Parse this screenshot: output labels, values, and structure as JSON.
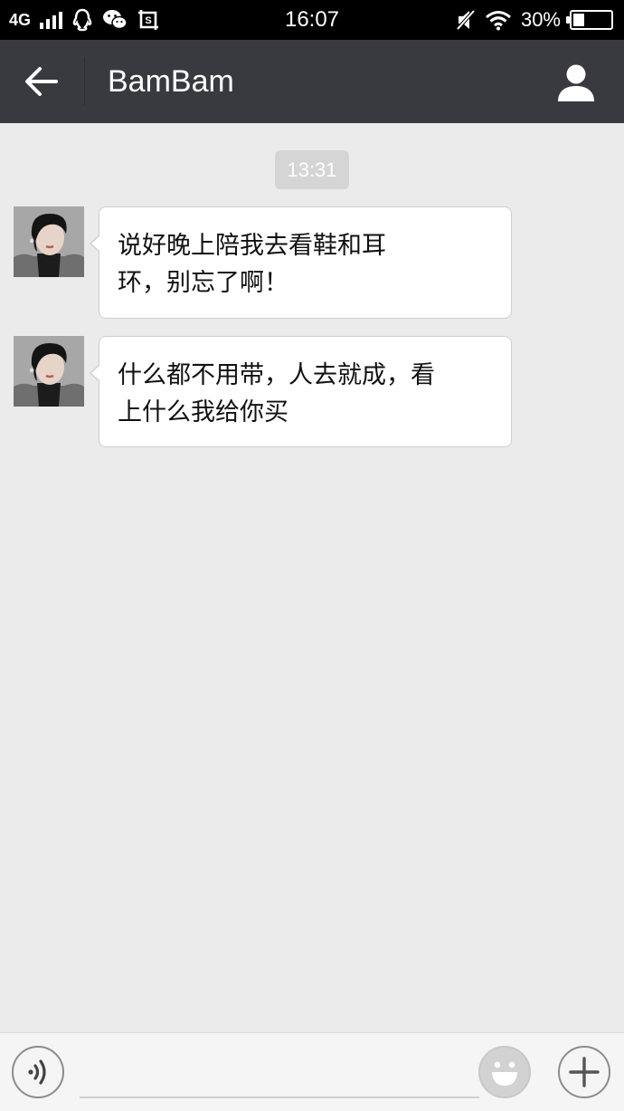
{
  "status_bar": {
    "network": "4G",
    "time": "16:07",
    "battery_text": "30%",
    "battery_level": 0.3,
    "icons": [
      "signal-icon",
      "qq-icon",
      "wechat-icon",
      "screenshot-icon",
      "mute-icon",
      "wifi-icon",
      "battery-icon"
    ]
  },
  "header": {
    "title": "BamBam",
    "back_icon": "arrow-left-icon",
    "profile_icon": "person-icon"
  },
  "chat": {
    "timestamp": "13:31",
    "messages": [
      {
        "sender": "BamBam",
        "line1": "说好晚上陪我去看鞋和耳",
        "line2": "环，别忘了啊！"
      },
      {
        "sender": "BamBam",
        "line1": "什么都不用带，人去就成，看",
        "line2": "上什么我给你买"
      }
    ]
  },
  "input_bar": {
    "text_value": "",
    "voice_icon": "voice-icon",
    "emoji_icon": "emoji-icon",
    "plus_icon": "plus-icon"
  },
  "colors": {
    "header_bg": "#393a3f",
    "chat_bg": "#ebebeb",
    "bubble_bg": "#ffffff",
    "timestamp_bg": "#d5d5d5"
  }
}
